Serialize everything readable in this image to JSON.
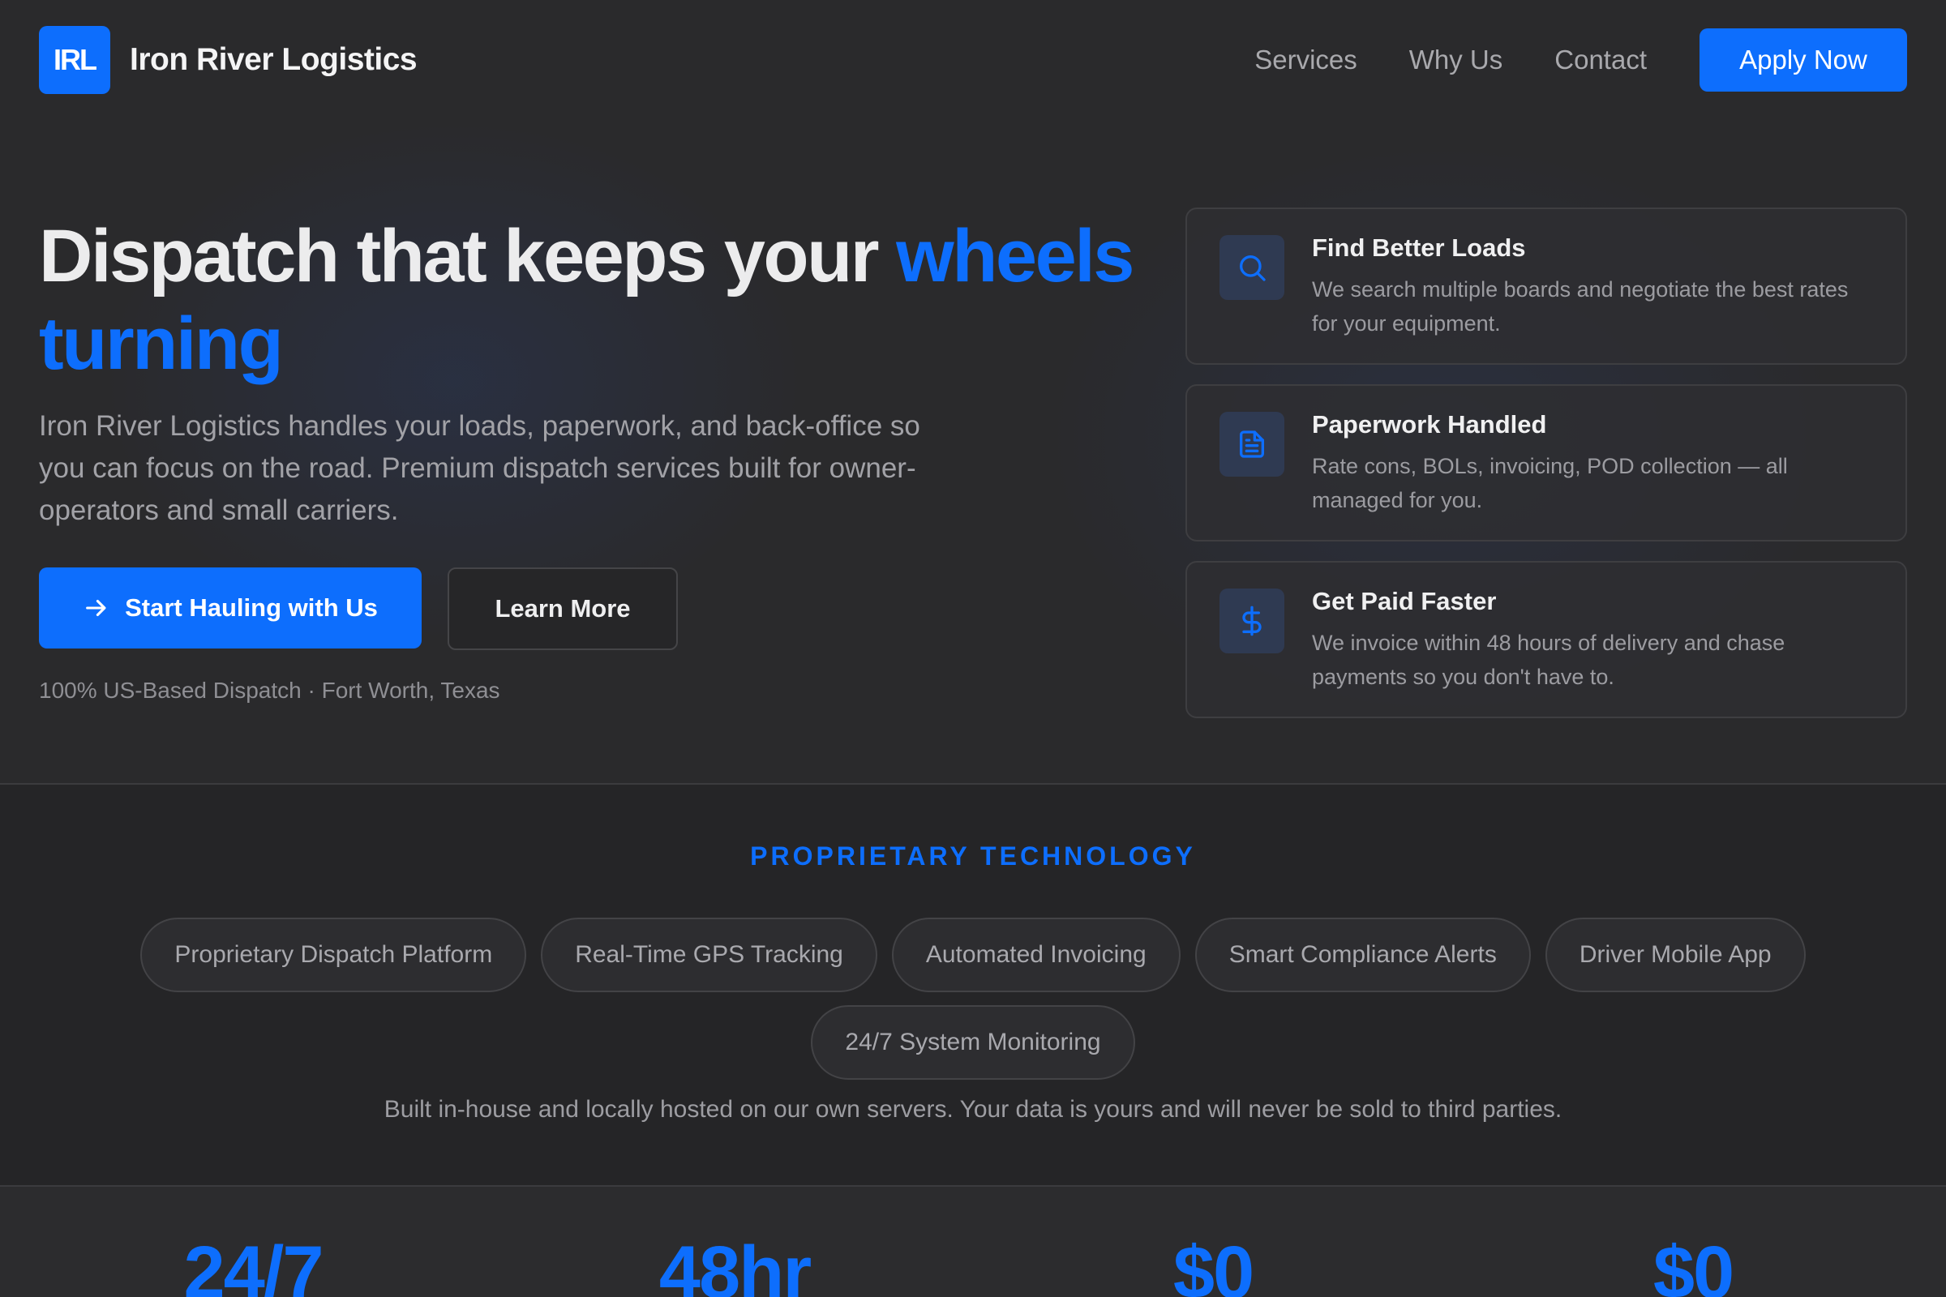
{
  "brand": {
    "logo_text": "IRL",
    "name": "Iron River Logistics"
  },
  "nav": {
    "items": [
      {
        "label": "Services"
      },
      {
        "label": "Why Us"
      },
      {
        "label": "Contact"
      }
    ],
    "cta_label": "Apply Now"
  },
  "hero": {
    "title_plain": "Dispatch that keeps your ",
    "title_accent": "wheels turning",
    "subtitle": "Iron River Logistics handles your loads, paperwork, and back-office so you can focus on the road. Premium dispatch services built for owner-operators and small carriers.",
    "primary_label": "Start Hauling with Us",
    "secondary_label": "Learn More",
    "note": "100% US-Based Dispatch · Fort Worth, Texas"
  },
  "features": [
    {
      "icon": "search-icon",
      "title": "Find Better Loads",
      "desc": "We search multiple boards and negotiate the best rates for your equipment."
    },
    {
      "icon": "document-icon",
      "title": "Paperwork Handled",
      "desc": "Rate cons, BOLs, invoicing, POD collection — all managed for you."
    },
    {
      "icon": "dollar-icon",
      "title": "Get Paid Faster",
      "desc": "We invoice within 48 hours of delivery and chase payments so you don't have to."
    }
  ],
  "tech": {
    "eyebrow": "PROPRIETARY TECHNOLOGY",
    "pills": [
      "Proprietary Dispatch Platform",
      "Real-Time GPS Tracking",
      "Automated Invoicing",
      "Smart Compliance Alerts",
      "Driver Mobile App",
      "24/7 System Monitoring"
    ],
    "note": "Built in-house and locally hosted on our own servers. Your data is yours and will never be sold to third parties."
  },
  "stats": [
    {
      "value": "24/7"
    },
    {
      "value": "48hr"
    },
    {
      "value": "$0"
    },
    {
      "value": "$0"
    }
  ],
  "colors": {
    "accent": "#0d6efd",
    "background": "#2a2a2c",
    "surface": "#252527"
  }
}
